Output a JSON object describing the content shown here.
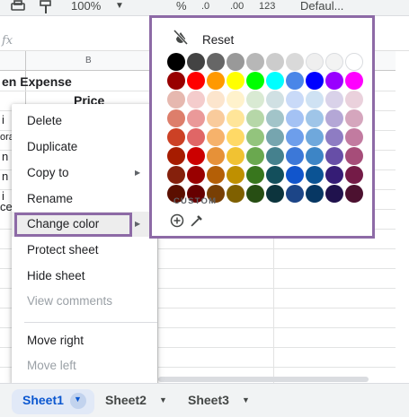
{
  "toolbar": {
    "zoom": "100%",
    "percent_symbol": "%",
    "decrease_decimal": ".0",
    "increase_decimal": ".00",
    "number_format": "123",
    "font_name": "Defaul..."
  },
  "formula_bar": {
    "fx": "fx"
  },
  "grid": {
    "col_header_b": "B",
    "title_cell": "en Expense",
    "price_header": "Price",
    "row_fragments": [
      "i",
      "ora",
      "n",
      "n",
      "i",
      "ce"
    ]
  },
  "context_menu": {
    "items": [
      {
        "label": "Delete",
        "enabled": true
      },
      {
        "label": "Duplicate",
        "enabled": true
      },
      {
        "label": "Copy to",
        "enabled": true,
        "has_submenu": true
      },
      {
        "label": "Rename",
        "enabled": true
      },
      {
        "label": "Change color",
        "enabled": true,
        "has_submenu": true,
        "highlighted": true
      },
      {
        "label": "Protect sheet",
        "enabled": true
      },
      {
        "label": "Hide sheet",
        "enabled": true
      },
      {
        "label": "View comments",
        "enabled": false
      },
      {
        "label": "Move right",
        "enabled": true
      },
      {
        "label": "Move left",
        "enabled": false
      }
    ]
  },
  "color_picker": {
    "reset_label": "Reset",
    "reset_icon": "no-fill-icon",
    "custom_label": "CUSTOM",
    "add_custom_icon": "plus-circle-icon",
    "eyedropper_icon": "eyedropper-icon",
    "rows": [
      [
        "#000000",
        "#434343",
        "#666666",
        "#999999",
        "#b7b7b7",
        "#cccccc",
        "#d9d9d9",
        "#efefef",
        "#f3f3f3",
        "#ffffff"
      ],
      [
        "#980000",
        "#ff0000",
        "#ff9900",
        "#ffff00",
        "#00ff00",
        "#00ffff",
        "#4a86e8",
        "#0000ff",
        "#9900ff",
        "#ff00ff"
      ],
      [
        "#e6b8af",
        "#f4cccc",
        "#fce5cd",
        "#fff2cc",
        "#d9ead3",
        "#d0e0e3",
        "#c9daf8",
        "#cfe2f3",
        "#d9d2e9",
        "#ead1dc"
      ],
      [
        "#dd7e6b",
        "#ea9999",
        "#f9cb9c",
        "#ffe599",
        "#b6d7a8",
        "#a2c4c9",
        "#a4c2f4",
        "#9fc5e8",
        "#b4a7d6",
        "#d5a6bd"
      ],
      [
        "#cc4125",
        "#e06666",
        "#f6b26b",
        "#ffd966",
        "#93c47d",
        "#76a5af",
        "#6d9eeb",
        "#6fa8dc",
        "#8e7cc3",
        "#c27ba0"
      ],
      [
        "#a61c00",
        "#cc0000",
        "#e69138",
        "#f1c232",
        "#6aa84f",
        "#45818e",
        "#3c78d8",
        "#3d85c6",
        "#674ea7",
        "#a64d79"
      ],
      [
        "#85200c",
        "#990000",
        "#b45f06",
        "#bf9000",
        "#38761d",
        "#134f5c",
        "#1155cc",
        "#0b5394",
        "#351c75",
        "#741b47"
      ],
      [
        "#5b0f00",
        "#660000",
        "#783f04",
        "#7f6000",
        "#274e13",
        "#0c343d",
        "#1c4587",
        "#073763",
        "#20124d",
        "#4c1130"
      ]
    ]
  },
  "colors": {
    "highlight_box": "#8d6aa6",
    "active_tab_bg": "#e1e9f7",
    "active_tab_text": "#0b57d0"
  },
  "sheet_tabs": [
    {
      "label": "Sheet1",
      "active": true
    },
    {
      "label": "Sheet2",
      "active": false
    },
    {
      "label": "Sheet3",
      "active": false
    }
  ]
}
